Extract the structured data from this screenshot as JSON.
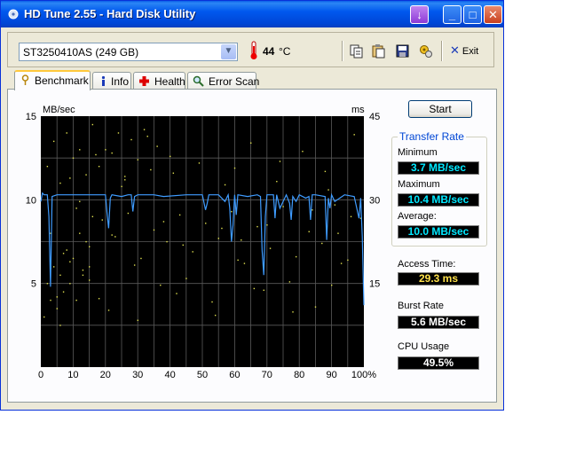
{
  "window": {
    "title": "HD Tune 2.55 - Hard Disk Utility",
    "controls": {
      "download": "↓",
      "minimize": "_",
      "maximize": "□",
      "close": "✕"
    }
  },
  "toolbar": {
    "drive": "ST3250410AS (249 GB)",
    "temperature": "44",
    "temperature_unit": "°C",
    "exit_label": "Exit",
    "icons": [
      "copy-icon",
      "paste-icon",
      "save-icon",
      "options-icon"
    ]
  },
  "tabs": [
    {
      "label": "Benchmark",
      "icon": "benchmark-icon",
      "active": true
    },
    {
      "label": "Info",
      "icon": "info-icon",
      "active": false
    },
    {
      "label": "Health",
      "icon": "health-icon",
      "active": false
    },
    {
      "label": "Error Scan",
      "icon": "magnifier-icon",
      "active": false
    }
  ],
  "benchmark": {
    "start_label": "Start",
    "transfer_rate_title": "Transfer Rate",
    "minimum_label": "Minimum",
    "minimum_value": "3.7 MB/sec",
    "maximum_label": "Maximum",
    "maximum_value": "10.4 MB/sec",
    "average_label": "Average:",
    "average_value": "10.0 MB/sec",
    "access_time_label": "Access Time:",
    "access_time_value": "29.3 ms",
    "burst_rate_label": "Burst Rate",
    "burst_rate_value": "5.6 MB/sec",
    "cpu_usage_label": "CPU Usage",
    "cpu_usage_value": "49.5%"
  },
  "chart_data": {
    "type": "line",
    "left_unit": "MB/sec",
    "right_unit": "ms",
    "left_ticks": [
      "15",
      "10",
      "5"
    ],
    "right_ticks": [
      "45",
      "30",
      "15"
    ],
    "x_ticks": [
      "0",
      "10",
      "20",
      "30",
      "40",
      "50",
      "60",
      "70",
      "80",
      "90",
      "100%"
    ],
    "xlim": [
      0,
      100
    ],
    "ylim": [
      0,
      15
    ],
    "y2lim": [
      0,
      45
    ],
    "grid": true,
    "series": [
      {
        "color": "#3f9cff",
        "x": [
          0,
          0.5,
          1,
          2,
          2.5,
          3,
          3.5,
          5,
          10,
          15,
          20,
          20.5,
          21,
          21.5,
          22,
          25,
          27,
          28,
          28.5,
          29,
          30,
          35,
          38,
          45,
          50,
          51,
          51.5,
          52,
          55,
          56,
          57,
          58,
          58.5,
          59,
          59.5,
          60,
          60.5,
          61,
          64,
          67,
          68,
          68.5,
          69,
          69.5,
          70,
          72,
          72.5,
          73,
          74,
          76,
          77,
          77.5,
          78,
          79,
          80,
          82,
          83,
          83.5,
          84,
          85,
          88,
          88.5,
          89,
          89.5,
          90,
          91,
          94,
          97,
          98.5,
          99,
          99.5,
          100
        ],
        "y": [
          9.9,
          10.4,
          10.3,
          10.3,
          9.0,
          4.8,
          10.2,
          10.3,
          10.3,
          10.3,
          10.3,
          9.2,
          8.3,
          10.1,
          10.3,
          10.2,
          10.3,
          10.3,
          9.3,
          10.2,
          10.3,
          10.3,
          10.2,
          10.3,
          10.3,
          9.4,
          9.8,
          10.3,
          10.3,
          10.1,
          9.9,
          10.3,
          9.5,
          7.5,
          8.5,
          10.3,
          9.1,
          10.3,
          10.2,
          10.3,
          10.2,
          7.0,
          5.5,
          9.0,
          10.3,
          10.3,
          8.9,
          10.3,
          9.5,
          10.3,
          9.8,
          8.8,
          10.2,
          9.9,
          10.3,
          10.1,
          10.2,
          8.8,
          10.3,
          10.3,
          10.2,
          7.6,
          10.1,
          9.5,
          10.3,
          9.9,
          10.3,
          10.2,
          8.9,
          10.1,
          7.8,
          3.7
        ]
      }
    ],
    "scatter": {
      "color": "#e0e050",
      "x": [
        1,
        2,
        3,
        4,
        5,
        6,
        7,
        8,
        9,
        10,
        11,
        12,
        13,
        14,
        15,
        16,
        2,
        4,
        6,
        8,
        10,
        12,
        14,
        16,
        18,
        20,
        22,
        24,
        26,
        28,
        30,
        32,
        34,
        36,
        3,
        7,
        11,
        15,
        19,
        23,
        27,
        31,
        35,
        39,
        43,
        47,
        51,
        55,
        59,
        63,
        67,
        71,
        75,
        79,
        83,
        87,
        91,
        95,
        99,
        5,
        13,
        21,
        29,
        37,
        45,
        53,
        61,
        69,
        77,
        85,
        93,
        9,
        17,
        25,
        33,
        41,
        49,
        57,
        65,
        73,
        81,
        89,
        97,
        6,
        18,
        30,
        42,
        54,
        66,
        78,
        90,
        12,
        26,
        40,
        60,
        74,
        88,
        3,
        9,
        15,
        22,
        38,
        44,
        56,
        62,
        70,
        84,
        92,
        96
      ],
      "y": [
        3,
        5,
        4,
        6,
        3.5,
        5.5,
        4.5,
        7,
        5,
        6.5,
        4,
        8,
        5.5,
        7.5,
        6,
        9,
        12,
        13.5,
        11,
        14,
        12.5,
        13,
        11.5,
        14.5,
        12,
        13,
        12.8,
        14,
        11.2,
        13.6,
        12.4,
        14.2,
        11.8,
        13.2,
        8,
        6.8,
        9.5,
        7.2,
        8.8,
        7.8,
        9.2,
        6.5,
        8.2,
        7.5,
        9.1,
        6.9,
        8.6,
        7.7,
        9.3,
        6.2,
        8.4,
        7.1,
        9.6,
        6.6,
        8.1,
        7.4,
        9.7,
        6.4,
        8.9,
        4.2,
        5.8,
        3.4,
        6.1,
        4.9,
        5.3,
        3.9,
        6.4,
        4.6,
        5.1,
        3.6,
        6.2,
        11.3,
        12.7,
        10.8,
        13.8,
        11.6,
        12.2,
        10.9,
        13.4,
        11.1,
        12.9,
        10.6,
        13.9,
        2.5,
        4.1,
        2.8,
        4.4,
        3.1,
        4.7,
        3.3,
        4.9,
        9.9,
        11.4,
        12.6,
        11.9,
        12.3,
        11.7,
        5.9,
        6.3,
        5.2,
        7.9,
        8.7,
        7.3,
        8.3,
        7.6,
        8.5,
        9.4,
        8.0,
        9.0
      ]
    }
  }
}
